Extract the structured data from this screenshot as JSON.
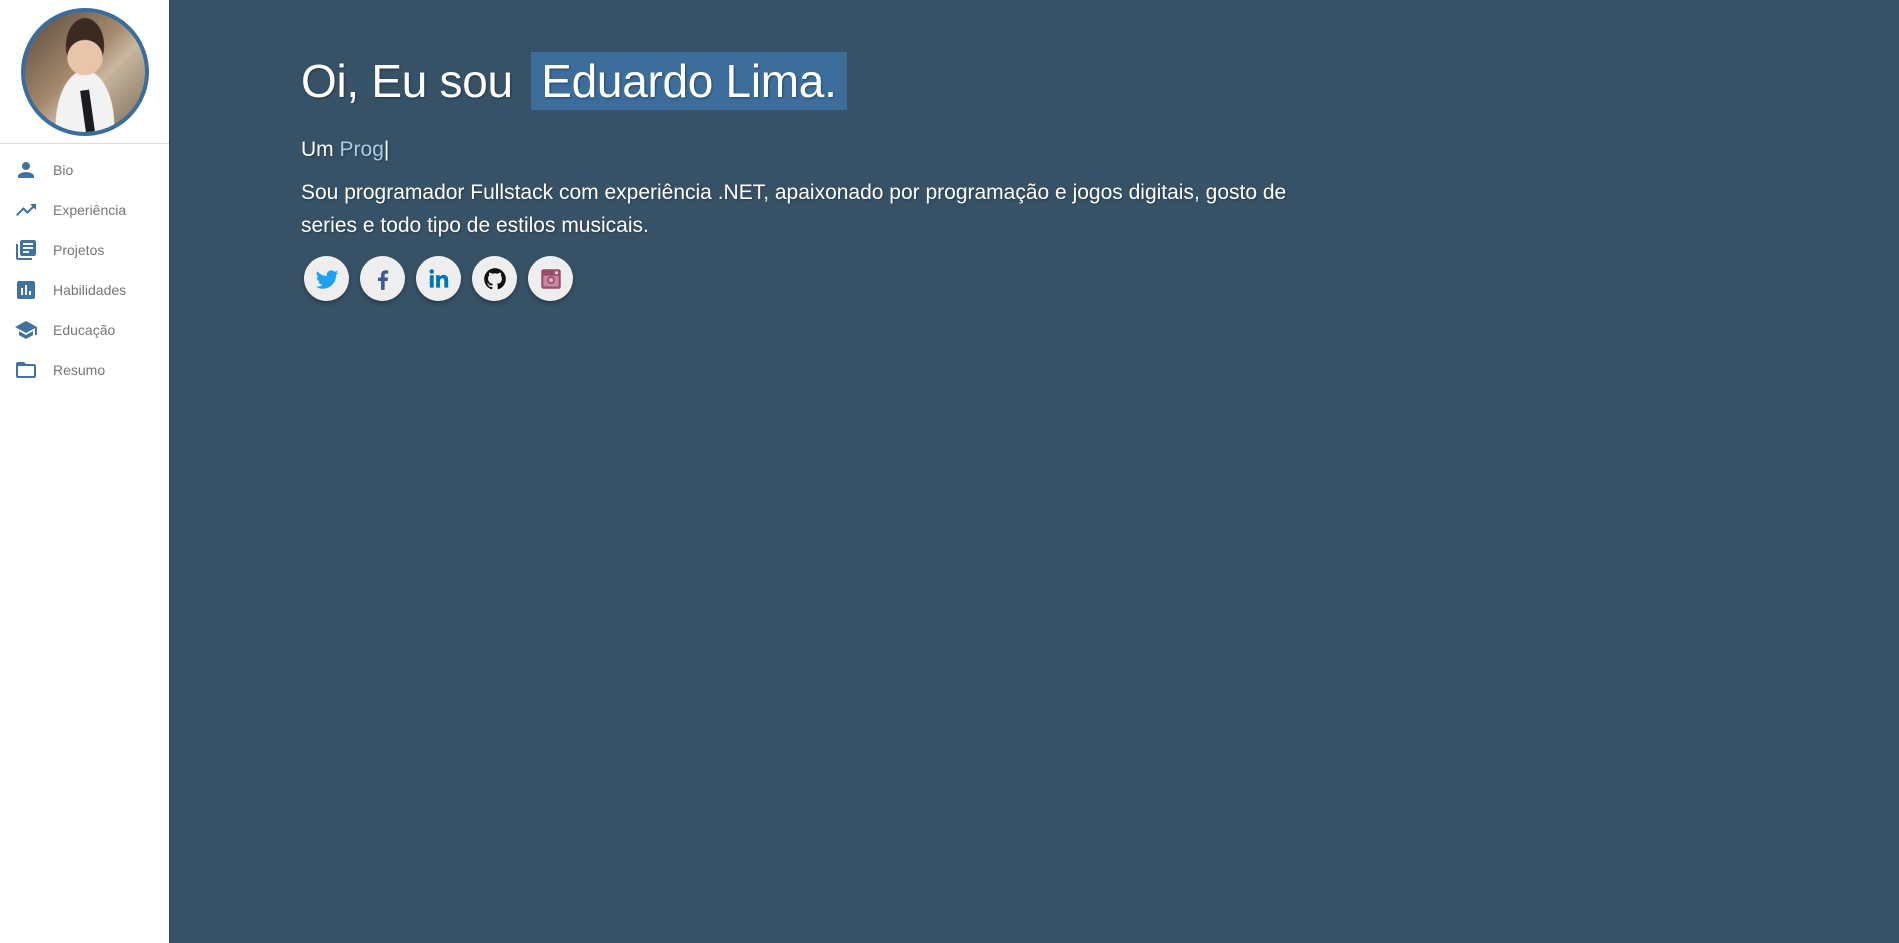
{
  "sidebar": {
    "items": [
      {
        "label": "Bio",
        "icon": "person-icon"
      },
      {
        "label": "Experiência",
        "icon": "trending-up-icon"
      },
      {
        "label": "Projetos",
        "icon": "library-books-icon"
      },
      {
        "label": "Habilidades",
        "icon": "bar-chart-icon"
      },
      {
        "label": "Educação",
        "icon": "graduation-cap-icon"
      },
      {
        "label": "Resumo",
        "icon": "folder-icon"
      }
    ]
  },
  "hero": {
    "greeting": "Oi, Eu sou",
    "name": "Eduardo Lima.",
    "role_prefix": "Um",
    "role_typed": "Prog",
    "cursor": "|",
    "bio": "Sou programador Fullstack com experiência .NET, apaixonado por programação e jogos digitais, gosto de series e todo tipo de estilos musicais."
  },
  "social": [
    {
      "icon": "twitter-icon",
      "color": "#1da1f2"
    },
    {
      "icon": "facebook-icon",
      "color": "#3b5998"
    },
    {
      "icon": "linkedin-icon",
      "color": "#0077b5"
    },
    {
      "icon": "github-icon",
      "color": "#111111"
    },
    {
      "icon": "instagram-icon",
      "color": "#9b4a6a"
    }
  ],
  "colors": {
    "background": "#375267",
    "accent": "#3d6e9b",
    "sidebar_icon": "#3f72a0",
    "typed_text": "#a7cde6"
  }
}
